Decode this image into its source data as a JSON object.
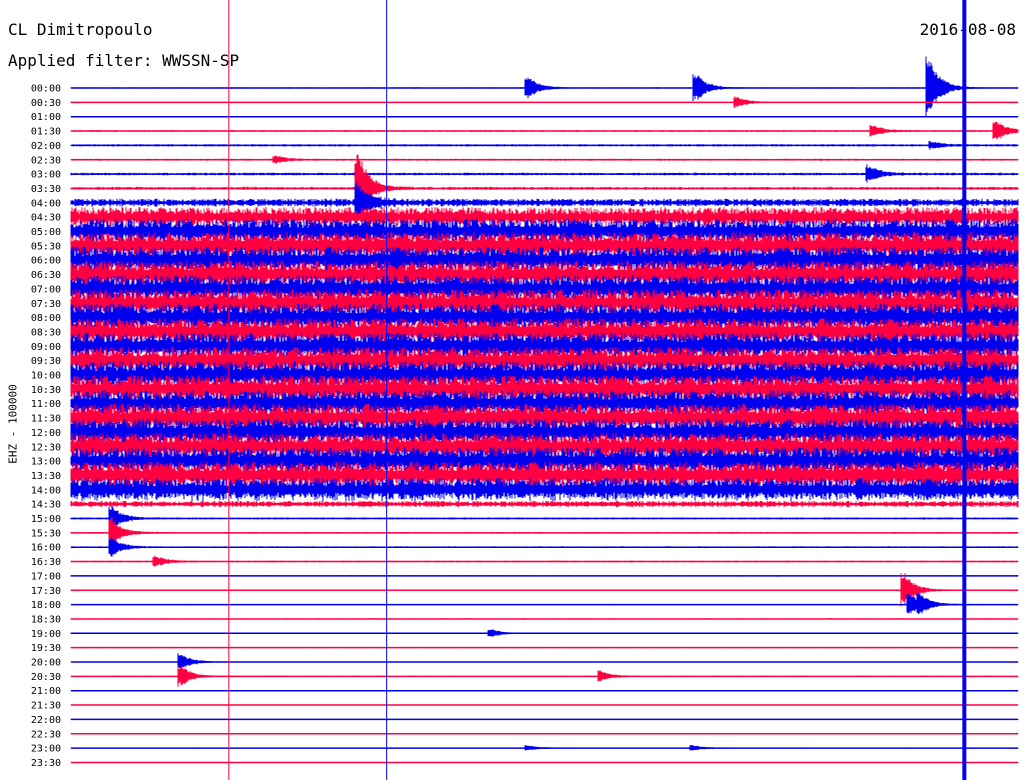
{
  "header": {
    "station": "CL Dimitropoulo",
    "filter": "Applied filter: WWSSN-SP",
    "date": "2016-08-08"
  },
  "chart_data": {
    "type": "line",
    "title": "CL Dimitropoulo",
    "subtitle": "Applied filter: WWSSN-SP",
    "date": "2016-08-08",
    "ylabel": "EHZ - 100000",
    "xlabel": "",
    "grid": false,
    "row_labels": [
      "00:00",
      "00:30",
      "01:00",
      "01:30",
      "02:00",
      "02:30",
      "03:00",
      "03:30",
      "04:00",
      "04:30",
      "05:00",
      "05:30",
      "06:00",
      "06:30",
      "07:00",
      "07:30",
      "08:00",
      "08:30",
      "09:00",
      "09:30",
      "10:00",
      "10:30",
      "11:00",
      "11:30",
      "12:00",
      "12:30",
      "13:00",
      "13:30",
      "14:00",
      "14:30",
      "15:00",
      "15:30",
      "16:00",
      "16:30",
      "17:00",
      "17:30",
      "18:00",
      "18:30",
      "19:00",
      "19:30",
      "20:00",
      "20:30",
      "21:00",
      "21:30",
      "22:00",
      "22:30",
      "23:00",
      "23:30"
    ],
    "trace_colors": [
      "#0000ee",
      "#ff0040"
    ],
    "noise_level": [
      0.08,
      0.06,
      0.06,
      0.1,
      0.14,
      0.12,
      0.16,
      0.18,
      0.45,
      1.1,
      1.4,
      1.5,
      1.5,
      1.5,
      1.5,
      1.55,
      1.55,
      1.5,
      1.5,
      1.5,
      1.55,
      1.55,
      1.5,
      1.55,
      1.5,
      1.5,
      1.55,
      1.5,
      1.3,
      0.35,
      0.12,
      0.1,
      0.1,
      0.1,
      0.08,
      0.08,
      0.07,
      0.07,
      0.07,
      0.06,
      0.06,
      0.06,
      0.06,
      0.05,
      0.05,
      0.05,
      0.06,
      0.05
    ],
    "events": [
      {
        "row": 0,
        "minute": 14.5,
        "amplitude": 1.6
      },
      {
        "row": 0,
        "minute": 19.8,
        "amplitude": 2.2
      },
      {
        "row": 0,
        "minute": 27.2,
        "amplitude": 4.5
      },
      {
        "row": 1,
        "minute": 21.1,
        "amplitude": 0.8
      },
      {
        "row": 3,
        "minute": 25.4,
        "amplitude": 0.9
      },
      {
        "row": 3,
        "minute": 29.3,
        "amplitude": 1.6
      },
      {
        "row": 4,
        "minute": 27.3,
        "amplitude": 0.5
      },
      {
        "row": 5,
        "minute": 6.5,
        "amplitude": 0.6
      },
      {
        "row": 6,
        "minute": 25.3,
        "amplitude": 1.2
      },
      {
        "row": 7,
        "minute": 9.1,
        "amplitude": 5.5
      },
      {
        "row": 8,
        "minute": 9.1,
        "amplitude": 2.8
      },
      {
        "row": 30,
        "minute": 1.3,
        "amplitude": 1.8
      },
      {
        "row": 31,
        "minute": 1.3,
        "amplitude": 2.2
      },
      {
        "row": 32,
        "minute": 1.3,
        "amplitude": 1.4
      },
      {
        "row": 33,
        "minute": 2.7,
        "amplitude": 0.8
      },
      {
        "row": 35,
        "minute": 26.4,
        "amplitude": 2.5
      },
      {
        "row": 36,
        "minute": 26.6,
        "amplitude": 1.6
      },
      {
        "row": 36,
        "minute": 26.9,
        "amplitude": 1.1
      },
      {
        "row": 38,
        "minute": 13.3,
        "amplitude": 0.6
      },
      {
        "row": 40,
        "minute": 3.5,
        "amplitude": 1.2
      },
      {
        "row": 41,
        "minute": 3.5,
        "amplitude": 1.6
      },
      {
        "row": 41,
        "minute": 16.8,
        "amplitude": 0.8
      },
      {
        "row": 46,
        "minute": 14.5,
        "amplitude": 0.4
      },
      {
        "row": 46,
        "minute": 19.7,
        "amplitude": 0.4
      }
    ],
    "vertical_markers": [
      {
        "minute": 5.0,
        "color": "#ff0040"
      },
      {
        "minute": 10.0,
        "color": "#0000ee"
      },
      {
        "minute": 28.3,
        "color": "#0000ee"
      }
    ]
  }
}
